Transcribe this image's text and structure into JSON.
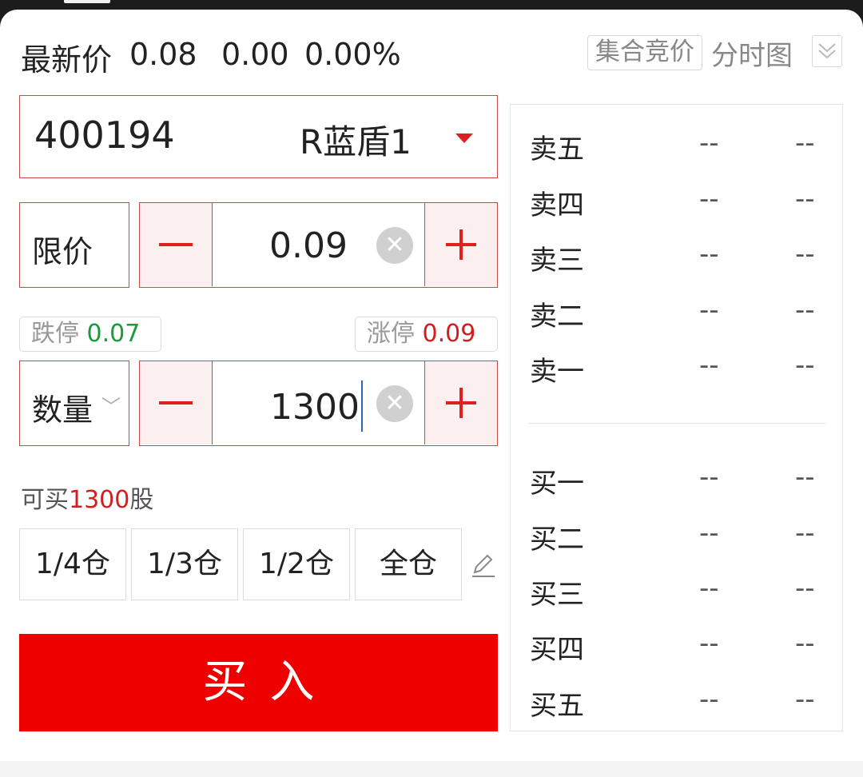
{
  "header": {
    "label": "最新价",
    "price": "0.08",
    "change": "0.00",
    "change_pct": "0.00%",
    "auction_tag": "集合竞价",
    "timeshare_link": "分时图",
    "collapse_icon": "double-chevron-down-icon"
  },
  "stock": {
    "code": "400194",
    "name": "R蓝盾1",
    "dropdown_icon": "caret-down-icon"
  },
  "price_field": {
    "type_label": "限价",
    "value": "0.09",
    "clear_icon": "clear-icon"
  },
  "limits": {
    "down_label": "跌停",
    "down_value": "0.07",
    "up_label": "涨停",
    "up_value": "0.09"
  },
  "quantity_field": {
    "label": "数量",
    "value": "1300",
    "clear_icon": "clear-icon"
  },
  "available": {
    "prefix": "可买",
    "amount": "1300",
    "suffix": "股"
  },
  "position_buttons": [
    "1/4仓",
    "1/3仓",
    "1/2仓",
    "全仓"
  ],
  "edit_icon": "edit-pencil-icon",
  "buy_button": "买入",
  "order_book": {
    "sell": [
      {
        "label": "卖五",
        "price": "--",
        "volume": "--"
      },
      {
        "label": "卖四",
        "price": "--",
        "volume": "--"
      },
      {
        "label": "卖三",
        "price": "--",
        "volume": "--"
      },
      {
        "label": "卖二",
        "price": "--",
        "volume": "--"
      },
      {
        "label": "卖一",
        "price": "--",
        "volume": "--"
      }
    ],
    "buy": [
      {
        "label": "买一",
        "price": "--",
        "volume": "--"
      },
      {
        "label": "买二",
        "price": "--",
        "volume": "--"
      },
      {
        "label": "买三",
        "price": "--",
        "volume": "--"
      },
      {
        "label": "买四",
        "price": "--",
        "volume": "--"
      },
      {
        "label": "买五",
        "price": "--",
        "volume": "--"
      }
    ]
  },
  "colors": {
    "accent_red": "#ee0000",
    "border_red": "#c64a4a",
    "limit_down_green": "#1a9a3a",
    "limit_up_red": "#d21e1e"
  }
}
